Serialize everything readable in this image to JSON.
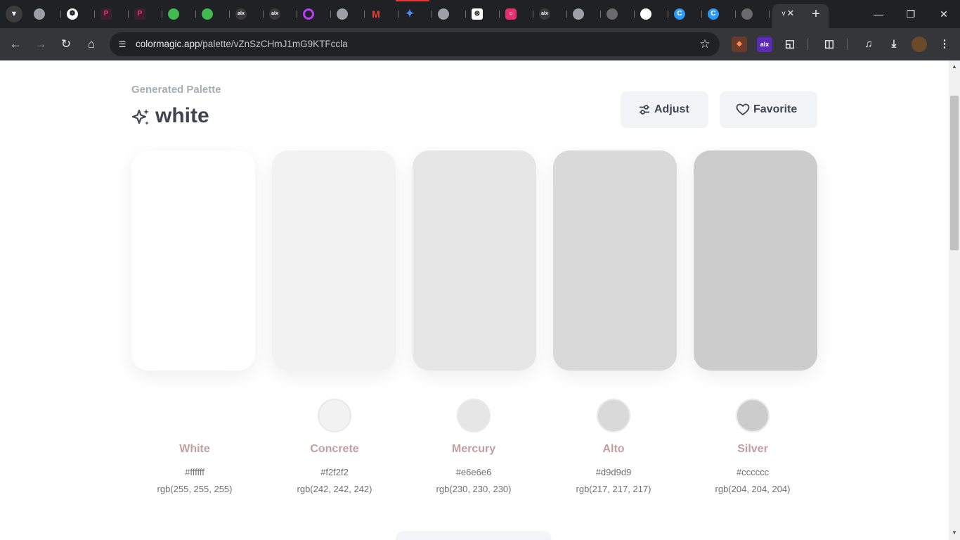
{
  "browser": {
    "tabs": [
      {
        "icon": "globe-icon",
        "color": "#9aa0a6"
      },
      {
        "icon": "chatgpt-icon",
        "color": "#ffffff"
      },
      {
        "icon": "pdf-icon",
        "color": "#e4405f"
      },
      {
        "icon": "pdf-icon",
        "color": "#e4405f"
      },
      {
        "icon": "github-icon",
        "color": "#3fb950"
      },
      {
        "icon": "github-icon",
        "color": "#3fb950"
      },
      {
        "icon": "alx-icon",
        "color": "#3a3a3a"
      },
      {
        "icon": "alx-icon",
        "color": "#3a3a3a"
      },
      {
        "icon": "target-icon",
        "color": "#b93cf6"
      },
      {
        "icon": "globe-icon",
        "color": "#9aa0a6"
      },
      {
        "icon": "gmail-icon",
        "color": "#ea4335"
      },
      {
        "icon": "gemini-icon",
        "color": "#4a8cf7"
      },
      {
        "icon": "globe-icon",
        "color": "#9aa0a6"
      },
      {
        "icon": "ai-icon",
        "color": "#ffffff"
      },
      {
        "icon": "instagram-icon",
        "color": "#e1306c"
      },
      {
        "icon": "alx-icon",
        "color": "#3a3a3a"
      },
      {
        "icon": "globe-icon",
        "color": "#9aa0a6"
      },
      {
        "icon": "dragon-icon",
        "color": "#6b6b6b"
      },
      {
        "icon": "github-icon",
        "color": "#ffffff"
      },
      {
        "icon": "c-icon",
        "color": "#2b9af3"
      },
      {
        "icon": "c-icon",
        "color": "#2b9af3"
      },
      {
        "icon": "dragon-icon",
        "color": "#6b6b6b"
      }
    ],
    "active_tab_icon": "v",
    "url_host": "colormagic.app",
    "url_path": "/palette/vZnSzCHmJ1mG9KTFccla"
  },
  "page": {
    "subtitle": "Generated Palette",
    "title": "white",
    "adjust_label": "Adjust",
    "favorite_label": "Favorite",
    "accent_text": "#c39da0"
  },
  "colors": [
    {
      "name": "White",
      "hex": "#ffffff",
      "rgb": "rgb(255, 255, 255)"
    },
    {
      "name": "Concrete",
      "hex": "#f2f2f2",
      "rgb": "rgb(242, 242, 242)"
    },
    {
      "name": "Mercury",
      "hex": "#e6e6e6",
      "rgb": "rgb(230, 230, 230)"
    },
    {
      "name": "Alto",
      "hex": "#d9d9d9",
      "rgb": "rgb(217, 217, 217)"
    },
    {
      "name": "Silver",
      "hex": "#cccccc",
      "rgb": "rgb(204, 204, 204)"
    }
  ]
}
